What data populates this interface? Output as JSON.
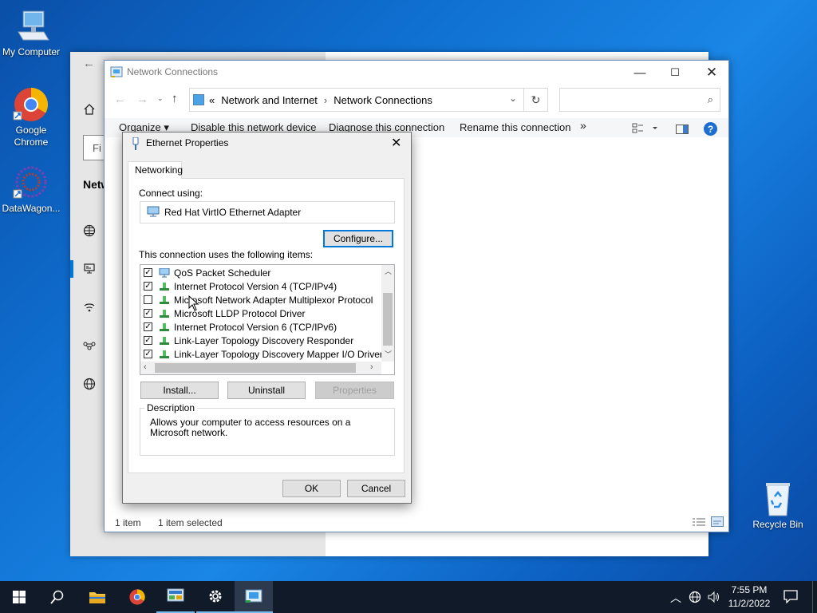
{
  "desktop": {
    "icons": [
      {
        "label": "My Computer"
      },
      {
        "label": "Google Chrome"
      },
      {
        "label": "DataWagon..."
      },
      {
        "label": "Recycle Bin"
      }
    ]
  },
  "network_connections": {
    "title": "Network Connections",
    "breadcrumb": {
      "chevron": "«",
      "part1": "Network and Internet",
      "sep": "›",
      "part2": "Network Connections"
    },
    "search_placeholder": "",
    "commands": {
      "organize": "Organize ▾",
      "disable": "Disable this network device",
      "diagnose": "Diagnose this connection",
      "rename": "Rename this connection",
      "more": "»"
    },
    "status": {
      "count": "1 item",
      "selected": "1 item selected"
    }
  },
  "settings_window": {
    "search_fragment": "Fi",
    "nav_title": "Netw"
  },
  "dialog": {
    "title": "Ethernet Properties",
    "tab": "Networking",
    "connect_using_label": "Connect using:",
    "adapter": "Red Hat VirtIO Ethernet Adapter",
    "configure": "Configure...",
    "items_label": "This connection uses the following items:",
    "items": [
      {
        "label": "QoS Packet Scheduler",
        "checked": true
      },
      {
        "label": "Internet Protocol Version 4 (TCP/IPv4)",
        "checked": true
      },
      {
        "label": "Microsoft Network Adapter Multiplexor Protocol",
        "checked": false
      },
      {
        "label": "Microsoft LLDP Protocol Driver",
        "checked": true
      },
      {
        "label": "Internet Protocol Version 6 (TCP/IPv6)",
        "checked": true
      },
      {
        "label": "Link-Layer Topology Discovery Responder",
        "checked": true
      },
      {
        "label": "Link-Layer Topology Discovery Mapper I/O Driver",
        "checked": true
      }
    ],
    "install": "Install...",
    "uninstall": "Uninstall",
    "properties": "Properties",
    "description_label": "Description",
    "description": "Allows your computer to access resources on a Microsoft network.",
    "ok": "OK",
    "cancel": "Cancel"
  },
  "taskbar": {
    "time": "7:55 PM",
    "date": "11/2/2022"
  },
  "colors": {
    "accent": "#0078d7",
    "taskbar": "#101a29"
  }
}
